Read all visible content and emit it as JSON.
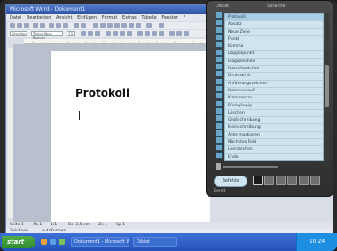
{
  "window": {
    "title": "Microsoft Word - Dokument1"
  },
  "menubar": {
    "items": [
      "Datei",
      "Bearbeiten",
      "Ansicht",
      "Einfügen",
      "Format",
      "Extras",
      "Tabelle",
      "Fenster",
      "?"
    ]
  },
  "formatting_toolbar": {
    "style": "Standard",
    "font": "Times New Roman",
    "size": "12"
  },
  "document": {
    "title": "Protokoll"
  },
  "statusbar": {
    "page": "Seite 1",
    "section": "Ab 1",
    "pages": "1/1",
    "position": "Bei 2,5 cm",
    "line": "Ze 1",
    "col": "Sp 1"
  },
  "drawbar": {
    "draw": "Zeichnen",
    "autoshapes": "AutoFormen"
  },
  "taskbar": {
    "start_label": "start",
    "buttons": [
      "Dokument1 - Microsoft Word",
      "Diktat"
    ],
    "clock": "10:24"
  },
  "panel": {
    "header_left": "Diktat",
    "header_right": "Sprache",
    "items": [
      "Protokoll",
      "Absatz",
      "Neue Zeile",
      "Punkt",
      "Komma",
      "Doppelpunkt",
      "Fragezeichen",
      "Ausrufezeichen",
      "Bindestrich",
      "Anführungszeichen",
      "Klammer auf",
      "Klammer zu",
      "Rückgängig",
      "Löschen",
      "Großschreibung",
      "Kleinschreibung",
      "Alles markieren",
      "Nächstes Feld",
      "Leerzeichen",
      "Ende"
    ],
    "selected_index": 0,
    "control_button": "Befehle",
    "footer": "Bereit"
  }
}
